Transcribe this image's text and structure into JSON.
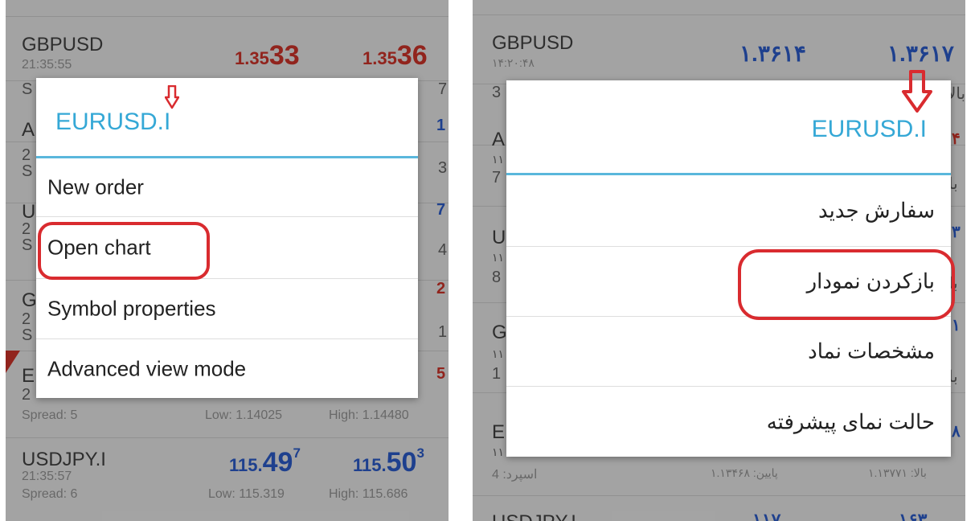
{
  "left": {
    "rows": [
      {
        "symbol": "GBPUSD",
        "time": "21:35:55",
        "spread": "S",
        "bid_a": "1.35",
        "bid_b": "33",
        "ask_a": "1.35",
        "ask_b": "36",
        "edge": "7"
      },
      {
        "symbol": "A",
        "time": "2",
        "spread": "S",
        "edge1": "1",
        "edge2": "3"
      },
      {
        "symbol": "U",
        "time": "2",
        "spread": "S",
        "edge1": "7",
        "edge2": "4"
      },
      {
        "symbol": "G",
        "time": "2",
        "spread": "S",
        "edge1": "2",
        "edge2": "1"
      },
      {
        "symbol": "E",
        "time": "2",
        "spread": "Spread: 5",
        "low": "Low: 1.14025",
        "high": "High: 1.14480",
        "edge1": "5"
      },
      {
        "symbol": "USDJPY.I",
        "time": "21:35:57",
        "spread": "Spread: 6",
        "bid_a": "115.",
        "bid_b": "49",
        "bid_sup": "7",
        "ask_a": "115.",
        "ask_b": "50",
        "ask_sup": "3",
        "low": "Low: 115.319",
        "high": "High: 115.686"
      }
    ],
    "dialog": {
      "title": "EURUSD.I",
      "items": [
        "New order",
        "Open chart",
        "Symbol properties",
        "Advanced view mode"
      ]
    }
  },
  "right": {
    "rows": [
      {
        "symbol": "GBPUSD",
        "time": "۱۴:۲۰:۴۸",
        "spread": "3",
        "bid": "۱.۳۶۱۴",
        "ask": "۱.۳۶۱۷",
        "edge": "بالا"
      },
      {
        "symbol": "A",
        "time": "۱۱",
        "spread": "7",
        "edge1": "۴",
        "edge2": "با"
      },
      {
        "symbol": "U",
        "time": "۱۱",
        "spread": "8",
        "edge1": "۳",
        "edge2": "با"
      },
      {
        "symbol": "G",
        "time": "۱۱",
        "spread": "1",
        "edge1": "۱",
        "edge2": "با"
      },
      {
        "symbol": "E",
        "time": "۱۱",
        "spread": "اسپرد: 4",
        "low": "پایین: ۱.۱۳۴۶۸",
        "high": "بالا: ۱.۱۳۷۷۱",
        "edge1": "۸"
      },
      {
        "symbol": "USDJPY.I",
        "bid": "۱۱۷",
        "ask": "۱۶۳"
      }
    ],
    "dialog": {
      "title": "EURUSD.I",
      "items": [
        "سفارش جدید",
        "بازکردن نمودار",
        "مشخصات نماد",
        "حالت نمای پیشرفته"
      ]
    }
  },
  "colors": {
    "accent": "#35a8d6",
    "highlight": "#d92b2f",
    "price_red": "#d6352c",
    "price_blue": "#2d5fd1"
  }
}
